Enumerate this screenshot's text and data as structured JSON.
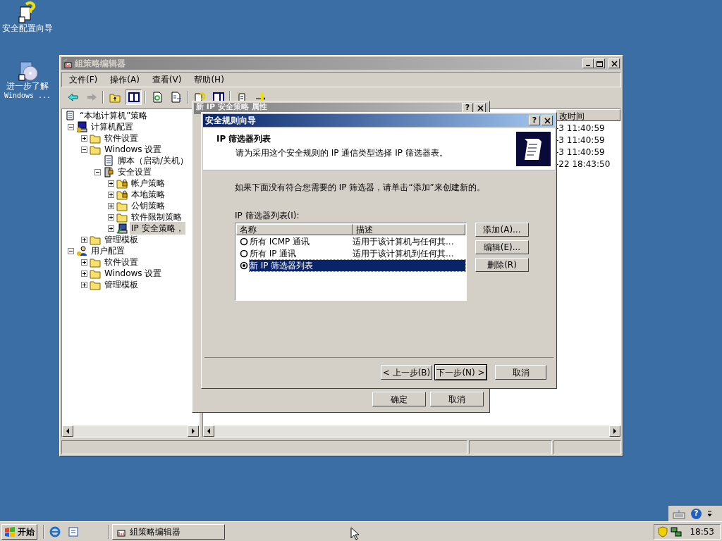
{
  "desktop_icons": [
    {
      "kind": "wizard",
      "lines": [
        "安全配置向导"
      ]
    },
    {
      "kind": "cd",
      "lines": [
        "进一步了解",
        "Windows ..."
      ]
    }
  ],
  "main_window": {
    "title": "組策略编辑器",
    "menu": [
      "文件(F)",
      "操作(A)",
      "查看(V)",
      "帮助(H)"
    ],
    "tree": [
      {
        "label": "“本地计算机”策略",
        "kind": "policy",
        "selected": false,
        "children": [
          {
            "label": "计算机配置",
            "kind": "computer",
            "expanded": true,
            "selected": false,
            "children": [
              {
                "label": "软件设置",
                "kind": "folder",
                "expanded": false,
                "selected": false
              },
              {
                "label": "Windows 设置",
                "kind": "folder",
                "expanded": true,
                "selected": false,
                "children": [
                  {
                    "label": "脚本（启动/关机）",
                    "kind": "script",
                    "selected": false
                  },
                  {
                    "label": "安全设置",
                    "kind": "security",
                    "expanded": true,
                    "selected": false,
                    "children": [
                      {
                        "label": "帐户策略",
                        "kind": "locked",
                        "expanded": false,
                        "selected": false
                      },
                      {
                        "label": "本地策略",
                        "kind": "locked",
                        "expanded": false,
                        "selected": false
                      },
                      {
                        "label": "公钥策略",
                        "kind": "folder",
                        "expanded": false,
                        "selected": false
                      },
                      {
                        "label": "软件限制策略",
                        "kind": "folder",
                        "expanded": false,
                        "selected": false
                      },
                      {
                        "label": "IP 安全策略，",
                        "kind": "ip",
                        "expanded": false,
                        "selected": true
                      }
                    ]
                  }
                ]
              },
              {
                "label": "管理模板",
                "kind": "folder",
                "expanded": false,
                "selected": false
              }
            ]
          },
          {
            "label": "用户配置",
            "kind": "user",
            "expanded": true,
            "selected": false,
            "children": [
              {
                "label": "软件设置",
                "kind": "folder",
                "expanded": false,
                "selected": false
              },
              {
                "label": "Windows 设置",
                "kind": "folder",
                "expanded": false,
                "selected": false
              },
              {
                "label": "管理模板",
                "kind": "folder",
                "expanded": false,
                "selected": false
              }
            ]
          }
        ]
      }
    ],
    "list_column": "改时间",
    "list_rows": [
      "-3 11:40:59",
      "-3 11:40:59",
      "-3 11:40:59",
      "-22 18:43:50"
    ]
  },
  "properties_dialog": {
    "title": "新 IP 安全策略 属性",
    "help": "?",
    "buttons": [
      "确定",
      "取消"
    ]
  },
  "wizard": {
    "title": "安全规则向导",
    "help": "?",
    "heading": "IP 筛选器列表",
    "subtitle": "请为采用这个安全规则的 IP 通信类型选择 IP 筛选器表。",
    "instruction": "如果下面没有符合您需要的 IP 筛选器，请单击“添加”来创建新的。",
    "list_label": "IP 筛选器列表(I):",
    "columns": [
      "名称",
      "描述"
    ],
    "rows": [
      {
        "name": "所有 ICMP 通讯",
        "description": "适用于该计算机与任何其...",
        "selected": false
      },
      {
        "name": "所有 IP 通讯",
        "description": "适用于该计算机到任何其...",
        "selected": false
      },
      {
        "name": "新 IP 筛选器列表",
        "selected": true
      }
    ],
    "side_buttons": [
      "添加(A)...",
      "编辑(E)...",
      "删除(R)"
    ],
    "nav_buttons": [
      "< 上一步(B)",
      "下一步(N) >",
      "取消"
    ]
  },
  "language_bar": {
    "help": "?"
  },
  "taskbar": {
    "start": "开始",
    "tasks": [
      {
        "label": "組策略编辑器",
        "selected": false
      }
    ],
    "clock": "18:53"
  }
}
